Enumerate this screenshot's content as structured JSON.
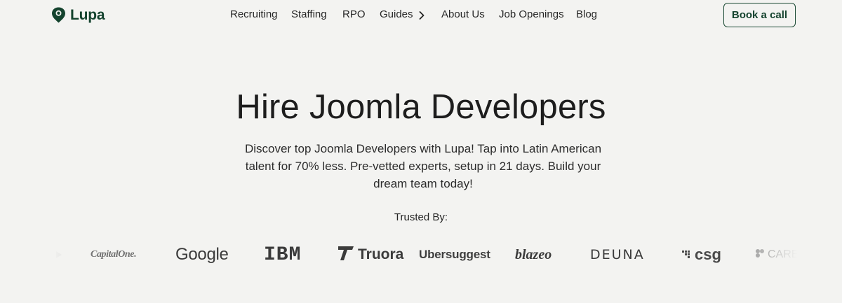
{
  "brand": {
    "name": "Lupa",
    "logo_icon": "lupa-pin-icon",
    "color": "#14432e"
  },
  "nav": {
    "recruiting": "Recruiting",
    "staffing": "Staffing",
    "rpo": "RPO",
    "guides": "Guides",
    "about": "About Us",
    "jobs": "Job Openings",
    "blog": "Blog"
  },
  "cta": {
    "label": "Book a call"
  },
  "hero": {
    "title": "Hire Joomla Developers",
    "subtitle": "Discover top Joomla Developers with Lupa! Tap into Latin American talent for 70% less. Pre-vetted experts, setup in 21 days. Build your dream team today!"
  },
  "trusted": {
    "label": "Trusted By:",
    "logos": [
      "CapitalOne.",
      "Google",
      "IBM",
      "Truora",
      "Ubersuggest",
      "blazeo",
      "DEUNA",
      "csg",
      "CARE"
    ]
  }
}
